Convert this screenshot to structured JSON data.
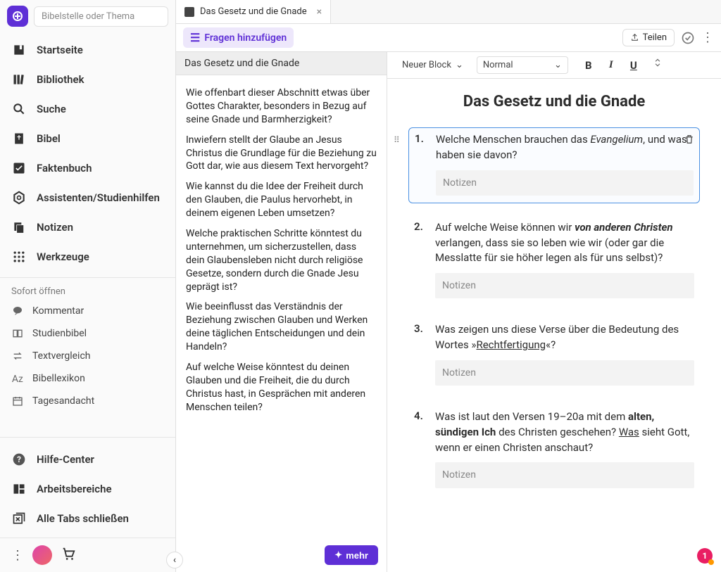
{
  "sidebar": {
    "search_placeholder": "Bibelstelle oder Thema",
    "nav": [
      {
        "id": "home",
        "label": "Startseite",
        "icon": "home"
      },
      {
        "id": "library",
        "label": "Bibliothek",
        "icon": "books"
      },
      {
        "id": "search",
        "label": "Suche",
        "icon": "search"
      },
      {
        "id": "bible",
        "label": "Bibel",
        "icon": "bible"
      },
      {
        "id": "factbook",
        "label": "Faktenbuch",
        "icon": "check"
      },
      {
        "id": "assistants",
        "label": "Assistenten/Studienhilfen",
        "icon": "hex"
      },
      {
        "id": "notes",
        "label": "Notizen",
        "icon": "copy"
      },
      {
        "id": "tools",
        "label": "Werkzeuge",
        "icon": "grid"
      }
    ],
    "quick_heading": "Sofort öffnen",
    "quick": [
      {
        "id": "commentary",
        "label": "Kommentar",
        "icon": "chat"
      },
      {
        "id": "studybible",
        "label": "Studienbibel",
        "icon": "book"
      },
      {
        "id": "textcompare",
        "label": "Textvergleich",
        "icon": "swap"
      },
      {
        "id": "lexicon",
        "label": "Bibellexikon",
        "icon": "az"
      },
      {
        "id": "devotional",
        "label": "Tagesandacht",
        "icon": "calendar"
      }
    ],
    "help": [
      {
        "id": "helpcenter",
        "label": "Hilfe-Center",
        "icon": "help"
      },
      {
        "id": "workspaces",
        "label": "Arbeitsbereiche",
        "icon": "panels"
      },
      {
        "id": "closealltabs",
        "label": "Alle Tabs schließen",
        "icon": "close-tabs"
      }
    ]
  },
  "tab": {
    "title": "Das Gesetz und die Gnade"
  },
  "toolbar": {
    "add_questions": "Fragen hinzufügen",
    "share": "Teilen"
  },
  "left_panel": {
    "title": "Das Gesetz und die Gnade",
    "more": "mehr",
    "questions": [
      "Wie offenbart dieser Abschnitt etwas über Gottes Charakter, besonders in Bezug auf seine Gnade und Barmherzigkeit?",
      "Inwiefern stellt der Glaube an Jesus Christus die Grundlage für die Beziehung zu Gott dar, wie aus diesem Text hervorgeht?",
      "Wie kannst du die Idee der Freiheit durch den Glauben, die Paulus hervorhebt, in deinem eigenen Leben umsetzen?",
      "Welche praktischen Schritte könntest du unternehmen, um sicherzustellen, dass dein Glaubensleben nicht durch religiöse Gesetze, sondern durch die Gnade Jesu geprägt ist?",
      "Wie beeinflusst das Verständnis der Beziehung zwischen Glauben und Werken deine täglichen Entscheidungen und dein Handeln?",
      "Auf welche Weise könntest du deinen Glauben und die Freiheit, die du durch Christus hast, in Gesprächen mit anderen Menschen teilen?"
    ]
  },
  "editor": {
    "block_dropdown": "Neuer Block",
    "style_dropdown": "Normal",
    "title": "Das Gesetz und die Gnade",
    "notes_placeholder": "Notizen",
    "items": [
      {
        "num": "1.",
        "html": "Welche Menschen brauchen das <em>Evangelium</em>, und was haben sie davon?",
        "active": true
      },
      {
        "num": "2.",
        "html": "Auf welche Weise können wir <strong><em>von anderen Christen</em></strong> verlangen, dass sie so leben wie wir (oder gar die Messlatte für sie höher legen als für uns selbst)?"
      },
      {
        "num": "3.",
        "html": "Was zeigen uns diese Verse über die Bedeutung des Wortes »<span class=\"ul\">Rechtfertigung</span>«?"
      },
      {
        "num": "4.",
        "html": "Was ist laut den Versen 19–20a mit dem <strong>alten, sündigen Ich</strong> des Christen geschehen? <span class=\"ul\">Was</span> sieht Gott, wenn er einen Christen anschaut?"
      }
    ]
  },
  "badge": "1"
}
